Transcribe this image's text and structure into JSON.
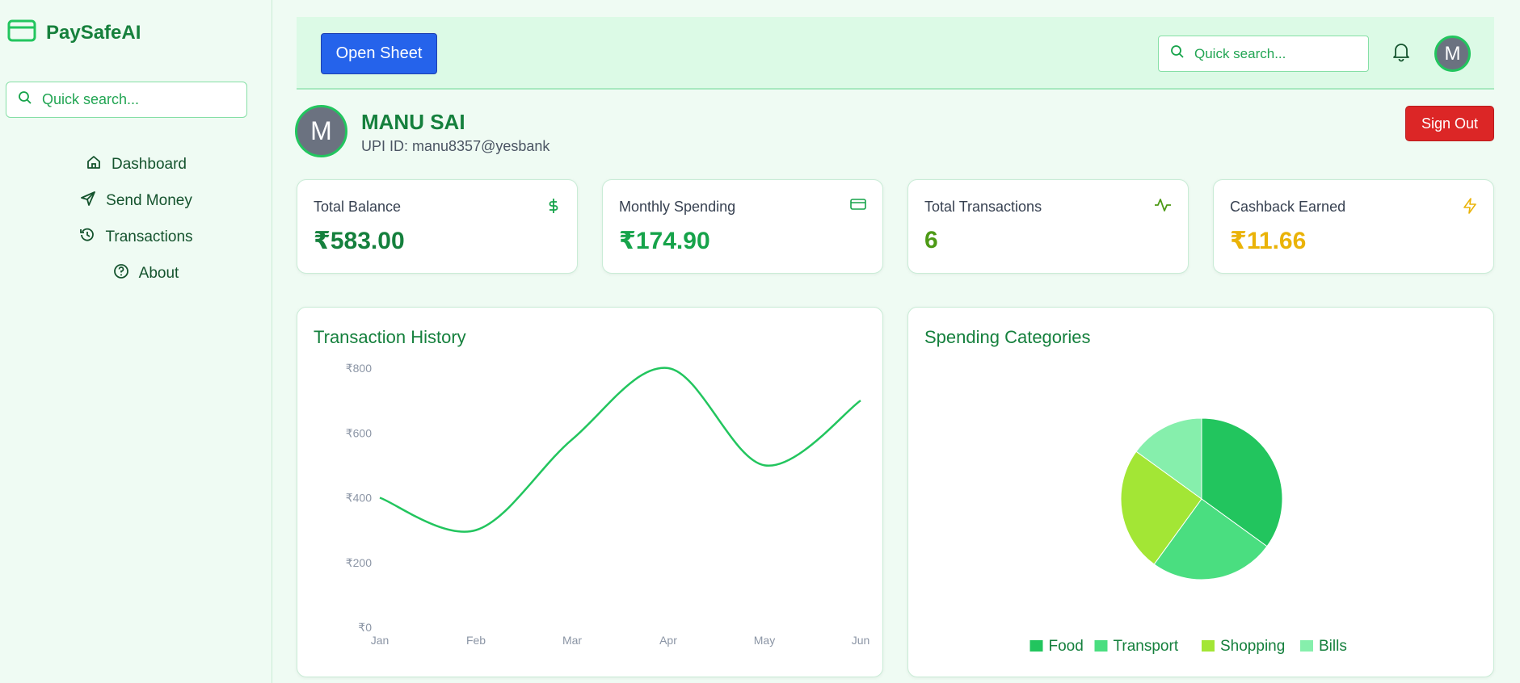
{
  "app": {
    "name": "PaySafeAI",
    "accent": "#16a34a"
  },
  "sidebar": {
    "search_placeholder": "Quick search...",
    "items": [
      {
        "label": "Dashboard",
        "icon": "home-icon"
      },
      {
        "label": "Send Money",
        "icon": "send-icon"
      },
      {
        "label": "Transactions",
        "icon": "history-icon"
      },
      {
        "label": "About",
        "icon": "help-circle-icon"
      }
    ]
  },
  "header": {
    "open_sheet_label": "Open Sheet",
    "search_placeholder": "Quick search...",
    "avatar_initial": "M"
  },
  "profile": {
    "avatar_initial": "M",
    "name": "MANU SAI",
    "upi": "UPI ID: manu8357@yesbank",
    "signout_label": "Sign Out"
  },
  "stats": [
    {
      "label": "Total Balance",
      "value": "₹583.00",
      "color": "#15803d",
      "icon": "dollar-icon"
    },
    {
      "label": "Monthly Spending",
      "value": "₹174.90",
      "color": "#16a34a",
      "icon": "credit-card-icon"
    },
    {
      "label": "Total Transactions",
      "value": "6",
      "color": "#4d9a16",
      "icon": "activity-icon"
    },
    {
      "label": "Cashback Earned",
      "value": "₹11.66",
      "color": "#eab308",
      "icon": "zap-icon"
    }
  ],
  "chart_data": [
    {
      "type": "line",
      "title": "Transaction History",
      "x": [
        "Jan",
        "Feb",
        "Mar",
        "Apr",
        "May",
        "Jun"
      ],
      "series": [
        {
          "values": [
            400,
            300,
            580,
            800,
            500,
            700
          ]
        }
      ],
      "yticks": [
        "₹0",
        "₹200",
        "₹400",
        "₹600",
        "₹800"
      ],
      "ylim": [
        0,
        800
      ],
      "color": "#22c55e",
      "grid": false
    },
    {
      "type": "pie",
      "title": "Spending Categories",
      "categories": [
        "Food",
        "Transport",
        "Shopping",
        "Bills"
      ],
      "values": [
        35,
        25,
        25,
        15
      ],
      "colors": [
        "#22c55e",
        "#4ade80",
        "#a3e635",
        "#86efac"
      ],
      "legend": "bottom"
    }
  ]
}
